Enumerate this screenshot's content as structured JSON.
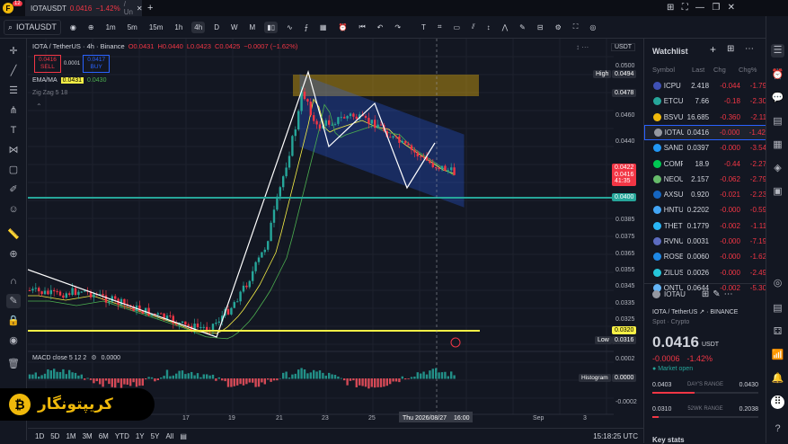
{
  "tab": {
    "notif": "12",
    "title": "IOTAUSDT",
    "price": "0.0416",
    "change": "−1.42%",
    "rest": "/ Un"
  },
  "toolbar": {
    "symbol": "IOTAUSDT",
    "intervals": [
      "1m",
      "5m",
      "15m",
      "1h",
      "4h",
      "D",
      "W",
      "M"
    ],
    "active": "4h"
  },
  "legend": {
    "title": "IOTA / TetherUS · 4h · Binance",
    "o": "O0.0431",
    "h": "H0.0440",
    "l": "L0.0423",
    "c": "C0.0425",
    "chg": "−0.0007 (−1.62%)",
    "sell_price": "0.0416",
    "sell": "SELL",
    "spread": "0.0001",
    "buy_price": "0.0417",
    "buy": "BUY",
    "ema_label": "EMA/MA",
    "ema1": "0.0431",
    "ema2": "0.0430",
    "zigzag": "Zig Zag 5 18"
  },
  "macd": {
    "label": "MACD close 5 12 2",
    "value": "0.0000",
    "hist_label": "Histogram",
    "hist_value": "0.0000"
  },
  "yaxis": {
    "currency": "USDT",
    "ticks": [
      "0.0500",
      "0.0460",
      "0.0440",
      "0.0385",
      "0.0375",
      "0.0365",
      "0.0355",
      "0.0345",
      "0.0335",
      "0.0325"
    ],
    "high_label": "High",
    "high": "0.0494",
    "mark": "0.0478",
    "last": "0.0422",
    "last_sub1": "0.0416",
    "last_sub2": "41:35",
    "level400": "0.0400",
    "level320": "0.0320",
    "low_label": "Low",
    "low": "0.0316",
    "macd_ticks": [
      "0.0002",
      "0.0000",
      "-0.0002"
    ]
  },
  "xaxis": {
    "labels": [
      "17",
      "19",
      "21",
      "23",
      "25",
      "27",
      "Sep",
      "3"
    ],
    "crosshair": "Thu 2026/08/27",
    "crosshair_time": "16:00"
  },
  "bottom": {
    "ranges": [
      "1D",
      "5D",
      "1M",
      "3M",
      "6M",
      "YTD",
      "1Y",
      "5Y",
      "All"
    ],
    "clock": "15:18:25 UTC"
  },
  "watchlist": {
    "title": "Watchlist",
    "headers": [
      "Symbol",
      "Last",
      "Chg",
      "Chg%"
    ],
    "rows": [
      {
        "sym": "ICPU",
        "last": "2.418",
        "chg": "-0.044",
        "pct": "-1.79",
        "color": "#3f51b5"
      },
      {
        "sym": "ETCU",
        "last": "7.66",
        "chg": "-0.18",
        "pct": "-2.30",
        "color": "#26a69a"
      },
      {
        "sym": "BSVU",
        "last": "16.685",
        "chg": "-0.360",
        "pct": "-2.11",
        "color": "#f0b90b"
      },
      {
        "sym": "IOTAU",
        "last": "0.0416",
        "chg": "-0.000",
        "pct": "-1.42",
        "color": "#9598a1"
      },
      {
        "sym": "SAND",
        "last": "0.0397",
        "chg": "-0.000",
        "pct": "-3.54",
        "color": "#2196f3"
      },
      {
        "sym": "COMP",
        "last": "18.9",
        "chg": "-0.44",
        "pct": "-2.27",
        "color": "#00c853"
      },
      {
        "sym": "NEOU",
        "last": "2.157",
        "chg": "-0.062",
        "pct": "-2.79",
        "color": "#66bb6a"
      },
      {
        "sym": "AXSU",
        "last": "0.920",
        "chg": "-0.021",
        "pct": "-2.23",
        "color": "#1565c0"
      },
      {
        "sym": "HNTU",
        "last": "0.2202",
        "chg": "-0.000",
        "pct": "-0.59",
        "color": "#42a5f5"
      },
      {
        "sym": "THET",
        "last": "0.1779",
        "chg": "-0.002",
        "pct": "-1.11",
        "color": "#29b6f6"
      },
      {
        "sym": "RVNU",
        "last": "0.0031",
        "chg": "-0.000",
        "pct": "-7.19",
        "color": "#5c6bc0"
      },
      {
        "sym": "ROSE",
        "last": "0.0060",
        "chg": "-0.000",
        "pct": "-1.62",
        "color": "#1e88e5"
      },
      {
        "sym": "ZILUS",
        "last": "0.0026",
        "chg": "-0.000",
        "pct": "-2.49",
        "color": "#26c6da"
      },
      {
        "sym": "ONTU",
        "last": "0.0644",
        "chg": "-0.002",
        "pct": "-5.30",
        "color": "#64b5f6"
      }
    ]
  },
  "details": {
    "sym": "IOTAU",
    "name": "IOTA / TetherUS",
    "exchange": "BINANCE",
    "type": "Spot · Crypto",
    "price": "0.0416",
    "currency": "USDT",
    "chg": "-0.0006",
    "pct": "-1.42%",
    "status": "Market open",
    "day_low": "0.0403",
    "day_range": "DAY'S RANGE",
    "day_high": "0.0430",
    "wk_low": "0.0310",
    "wk_range": "52WK RANGE",
    "wk_high": "0.2038",
    "key_stats": "Key stats"
  },
  "brand": {
    "text": "کریپتونگار"
  }
}
